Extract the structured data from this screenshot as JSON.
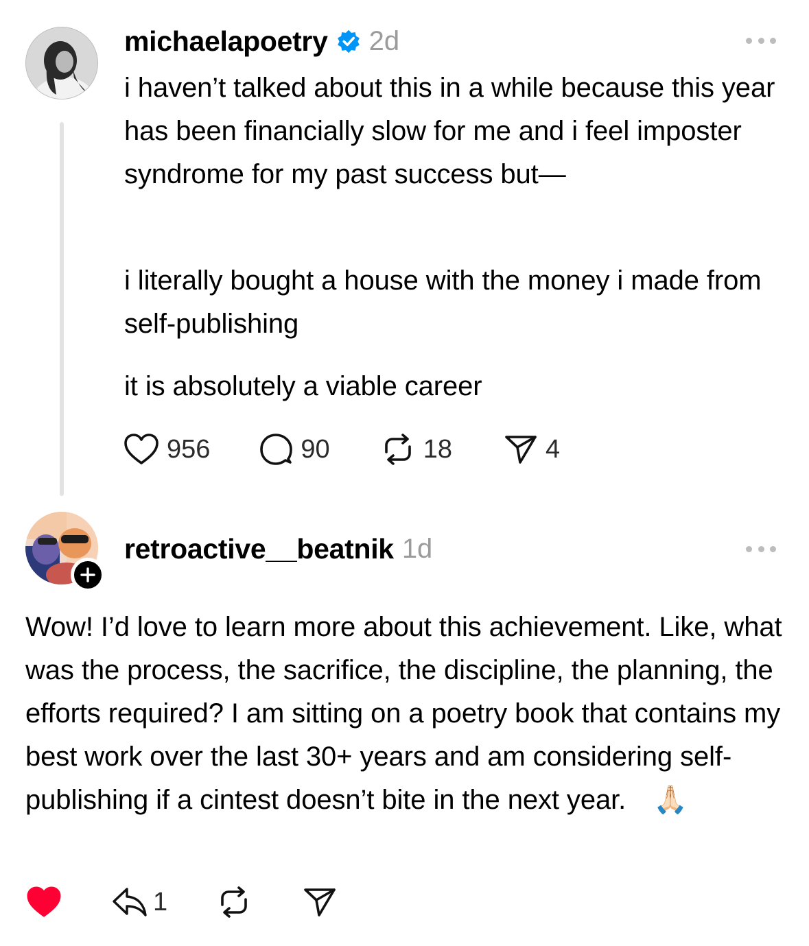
{
  "post": {
    "username": "michaelapoetry",
    "verified": true,
    "timestamp": "2d",
    "paragraph_1": "i haven’t talked about this in a while because this year has been financially slow for me and i feel imposter syndrome for my past success but—",
    "paragraph_2": "i literally bought a house with the money i made from self-publishing",
    "paragraph_3": "it is absolutely a viable career",
    "likes": "956",
    "comments": "90",
    "reposts": "18",
    "shares": "4"
  },
  "reply": {
    "username": "retroactive__beatnik",
    "timestamp": "1d",
    "text": "Wow! I’d love to learn more about this achievement. Like, what was the process, the sacrifice, the discipline, the planning, the efforts required? I am sitting on a poetry book that contains my best work over the last 30+ years and am considering self-publishing if a cintest doesn’t bite in the next year.",
    "emoji": "🙏🏻",
    "liked": true,
    "reply_count": "1"
  },
  "icons": {
    "verified": "verified-badge-icon",
    "more": "more-dots-icon",
    "like": "heart-icon",
    "comment": "comment-bubble-icon",
    "repost": "repost-icon",
    "share": "send-icon",
    "reply": "reply-arrow-icon",
    "follow": "plus-icon"
  },
  "colors": {
    "verified_blue": "#0095f6",
    "like_red": "#ff0034",
    "muted_gray": "#9b9b9b",
    "thread_line": "#e3e3e3"
  }
}
